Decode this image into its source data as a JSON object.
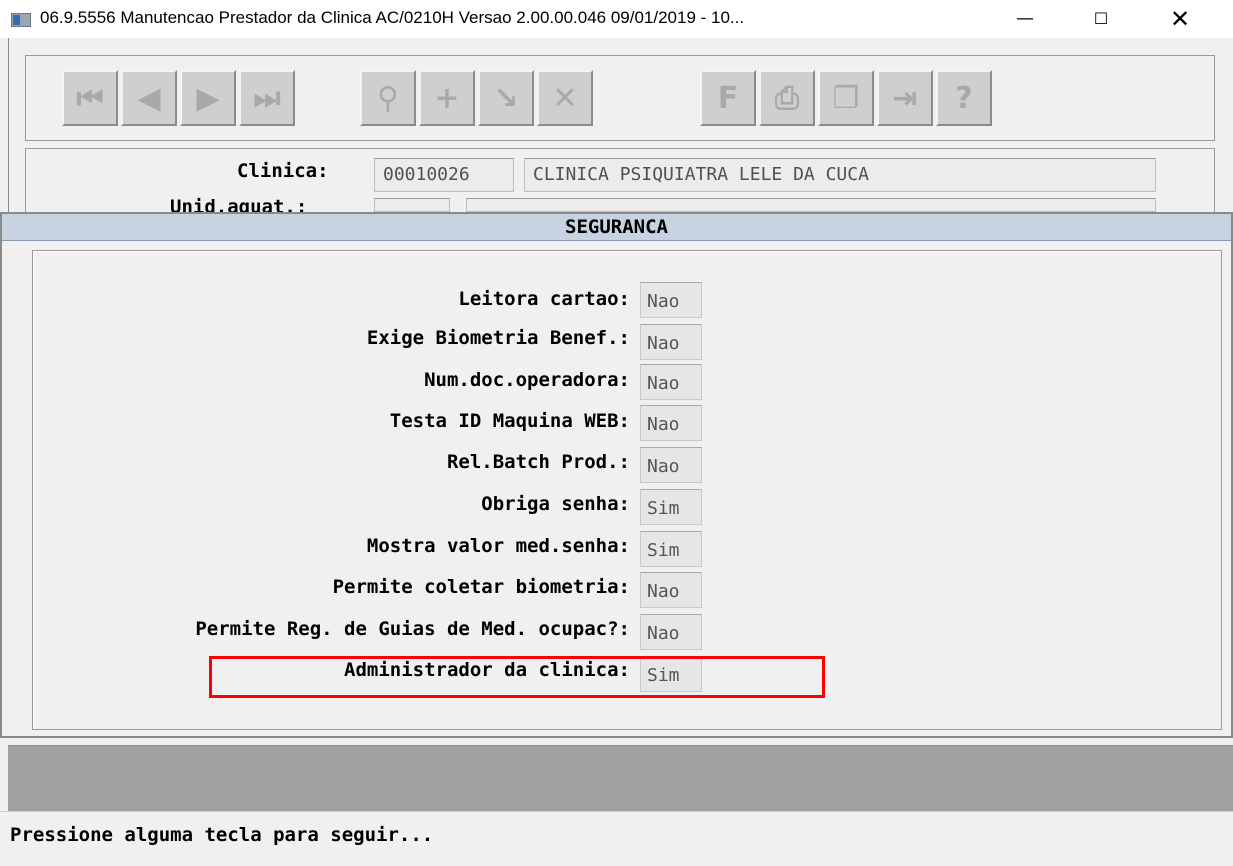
{
  "window": {
    "title": "06.9.5556 Manutencao  Prestador da Clinica AC/0210H Versao 2.00.00.046 09/01/2019 - 10...",
    "min_glyph": "—",
    "max_glyph": "☐",
    "close_glyph": "✕"
  },
  "toolbar": {
    "buttons": [
      {
        "icon": "first-record-icon",
        "glyph": "⏮"
      },
      {
        "icon": "previous-record-icon",
        "glyph": "◀"
      },
      {
        "icon": "next-record-icon",
        "glyph": "▶"
      },
      {
        "icon": "last-record-icon",
        "glyph": "⏭"
      },
      {
        "icon": "search-key-icon",
        "glyph": "⚲"
      },
      {
        "icon": "add-record-icon",
        "glyph": "+"
      },
      {
        "icon": "modify-record-icon",
        "glyph": "↘"
      },
      {
        "icon": "delete-record-icon",
        "glyph": "✕"
      },
      {
        "icon": "filter-icon",
        "glyph": "F"
      },
      {
        "icon": "print-icon",
        "glyph": "⎙"
      },
      {
        "icon": "copy-icon",
        "glyph": "❐"
      },
      {
        "icon": "exit-icon",
        "glyph": "⇥"
      },
      {
        "icon": "help-icon",
        "glyph": "?"
      }
    ]
  },
  "header": {
    "clinica_label": "Clinica:",
    "clinica_code": "00010026",
    "clinica_name": "CLINICA PSIQUIATRA LELE DA CUCA",
    "unid_label": "Unid.aquat.:"
  },
  "dialog": {
    "title": "SEGURANCA",
    "rows": [
      {
        "label": "Leitora cartao:",
        "value": "Nao"
      },
      {
        "label": "Exige Biometria Benef.:",
        "value": "Nao"
      },
      {
        "label": "Num.doc.operadora:",
        "value": "Nao"
      },
      {
        "label": "Testa ID Maquina WEB:",
        "value": "Nao"
      },
      {
        "label": "Rel.Batch Prod.:",
        "value": "Nao"
      },
      {
        "label": "Obriga senha:",
        "value": "Sim"
      },
      {
        "label": "Mostra valor med.senha:",
        "value": "Sim"
      },
      {
        "label": "Permite coletar biometria:",
        "value": "Nao"
      },
      {
        "label": "Permite Reg. de Guias de Med. ocupac?:",
        "value": "Nao"
      },
      {
        "label": "Administrador da clinica:",
        "value": "Sim"
      }
    ]
  },
  "status": {
    "message": "Pressione alguma tecla para seguir..."
  },
  "colors": {
    "highlight": "#ff0000",
    "dialog_title_bg": "#c7d3e0",
    "status_band": "#a0a0a0"
  }
}
